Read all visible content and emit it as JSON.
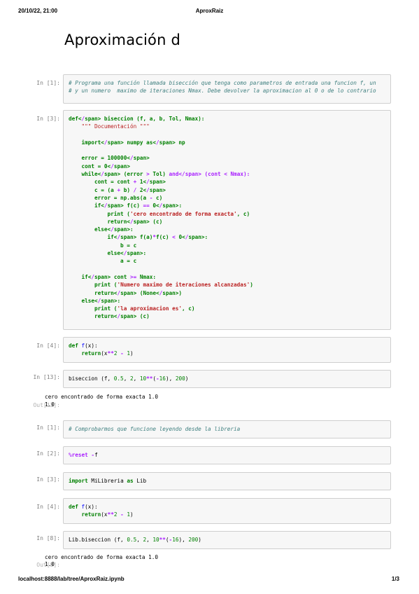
{
  "header": {
    "datetime": "20/10/22, 21:00",
    "title": "AproxRaiz"
  },
  "footer": {
    "url": "localhost:8888/lab/tree/AproxRaiz.ipynb",
    "page": "1/3"
  },
  "notebook": {
    "title": "Aproximación d",
    "cells": [
      {
        "prompt": "In [1]:",
        "lines": [
          "# Programa una función llamada bisección que tenga como parametros de entrada una funcion f, un",
          "# y un numero  maximo de iteraciones Nmax. Debe devolver la aproximacion al 0 o de lo contrario"
        ]
      },
      {
        "prompt": "In [3]:",
        "lines": [
          "def biseccion (f, a, b, Tol, Nmax):",
          "    \"\"\" Documentación \"\"\"",
          "",
          "    import numpy as np",
          "",
          "    error = 100000",
          "    cont = 0",
          "    while (error > Tol) and (cont < Nmax):",
          "        cont = cont + 1",
          "        c = (a + b) / 2",
          "        error = np.abs(a - c)",
          "        if f(c) == 0:",
          "            print ('cero encontrado de forma exacta', c)",
          "            return (c)",
          "        else:",
          "            if f(a)*f(c) < 0:",
          "                b = c",
          "            else:",
          "                a = c",
          "",
          "    if cont >= Nmax:",
          "        print ('Numero maximo de iteraciones alcanzadas')",
          "        return (None)",
          "    else:",
          "        print ('la aproximacion es', c)",
          "        return (c)"
        ]
      },
      {
        "prompt": "In [4]:",
        "lines": [
          "def f(x):",
          "    return(x**2 - 1)"
        ]
      },
      {
        "prompt": "In [13]:",
        "lines": [
          "biseccion (f, 0.5, 2, 10**(-16), 200)"
        ],
        "stdout": "cero encontrado de forma exacta 1.0",
        "out_prompt": "Out[13]:",
        "out": "1.0"
      },
      {
        "prompt": "In [1]:",
        "lines": [
          "# Comprobarmos que funcione leyendo desde la libreria"
        ]
      },
      {
        "prompt": "In [2]:",
        "lines": [
          "%reset -f"
        ]
      },
      {
        "prompt": "In [3]:",
        "lines": [
          "import MiLibreria as Lib"
        ]
      },
      {
        "prompt": "In [4]:",
        "lines": [
          "def f(x):",
          "    return(x**2 - 1)"
        ]
      },
      {
        "prompt": "In [8]:",
        "lines": [
          "Lib.biseccion (f, 0.5, 2, 10**(-16), 200)"
        ],
        "stdout": "cero encontrado de forma exacta 1.0",
        "out_prompt": "Out[8]:",
        "out": "1.0"
      }
    ]
  }
}
